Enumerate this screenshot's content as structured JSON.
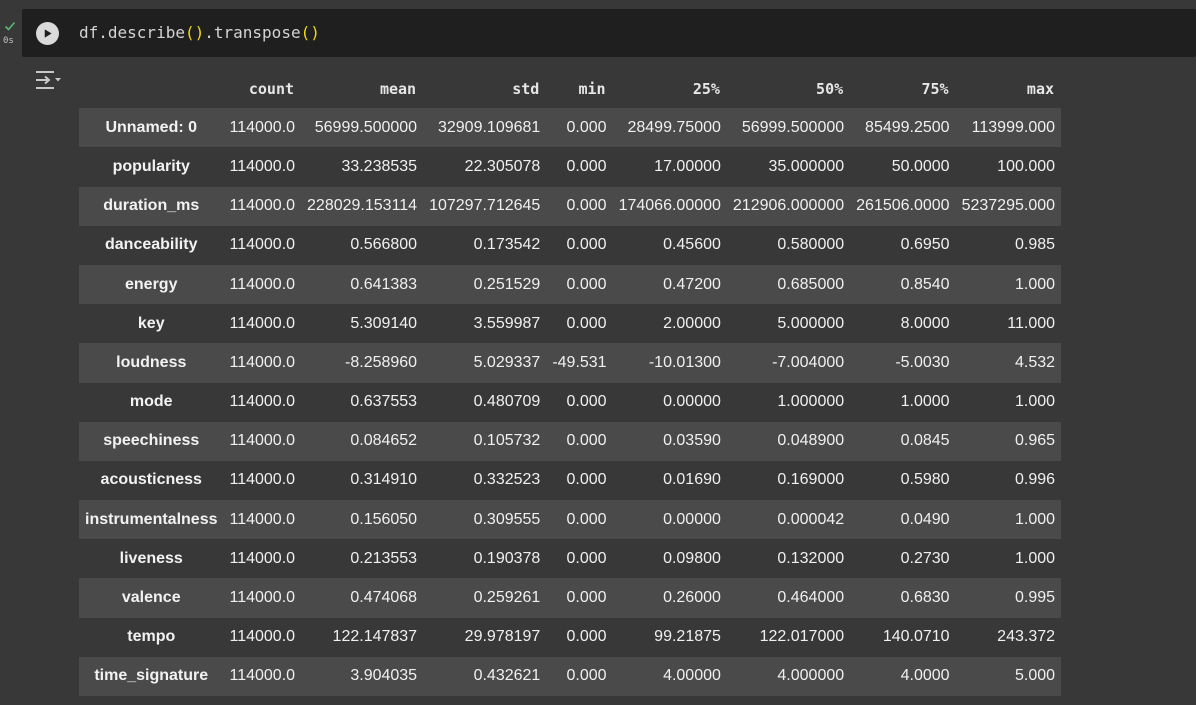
{
  "cell": {
    "exec_time": "0s",
    "code_parts": [
      "df.describe",
      "(",
      ")",
      ".transpose",
      "(",
      ")"
    ]
  },
  "table": {
    "columns": [
      "",
      "count",
      "mean",
      "std",
      "min",
      "25%",
      "50%",
      "75%",
      "max"
    ],
    "rows": [
      {
        "label": "Unnamed: 0",
        "values": [
          "114000.0",
          "56999.500000",
          "32909.109681",
          "0.000",
          "28499.75000",
          "56999.500000",
          "85499.2500",
          "113999.000"
        ]
      },
      {
        "label": "popularity",
        "values": [
          "114000.0",
          "33.238535",
          "22.305078",
          "0.000",
          "17.00000",
          "35.000000",
          "50.0000",
          "100.000"
        ]
      },
      {
        "label": "duration_ms",
        "values": [
          "114000.0",
          "228029.153114",
          "107297.712645",
          "0.000",
          "174066.00000",
          "212906.000000",
          "261506.0000",
          "5237295.000"
        ]
      },
      {
        "label": "danceability",
        "values": [
          "114000.0",
          "0.566800",
          "0.173542",
          "0.000",
          "0.45600",
          "0.580000",
          "0.6950",
          "0.985"
        ]
      },
      {
        "label": "energy",
        "values": [
          "114000.0",
          "0.641383",
          "0.251529",
          "0.000",
          "0.47200",
          "0.685000",
          "0.8540",
          "1.000"
        ]
      },
      {
        "label": "key",
        "values": [
          "114000.0",
          "5.309140",
          "3.559987",
          "0.000",
          "2.00000",
          "5.000000",
          "8.0000",
          "11.000"
        ]
      },
      {
        "label": "loudness",
        "values": [
          "114000.0",
          "-8.258960",
          "5.029337",
          "-49.531",
          "-10.01300",
          "-7.004000",
          "-5.0030",
          "4.532"
        ]
      },
      {
        "label": "mode",
        "values": [
          "114000.0",
          "0.637553",
          "0.480709",
          "0.000",
          "0.00000",
          "1.000000",
          "1.0000",
          "1.000"
        ]
      },
      {
        "label": "speechiness",
        "values": [
          "114000.0",
          "0.084652",
          "0.105732",
          "0.000",
          "0.03590",
          "0.048900",
          "0.0845",
          "0.965"
        ]
      },
      {
        "label": "acousticness",
        "values": [
          "114000.0",
          "0.314910",
          "0.332523",
          "0.000",
          "0.01690",
          "0.169000",
          "0.5980",
          "0.996"
        ]
      },
      {
        "label": "instrumentalness",
        "values": [
          "114000.0",
          "0.156050",
          "0.309555",
          "0.000",
          "0.00000",
          "0.000042",
          "0.0490",
          "1.000"
        ]
      },
      {
        "label": "liveness",
        "values": [
          "114000.0",
          "0.213553",
          "0.190378",
          "0.000",
          "0.09800",
          "0.132000",
          "0.2730",
          "1.000"
        ]
      },
      {
        "label": "valence",
        "values": [
          "114000.0",
          "0.474068",
          "0.259261",
          "0.000",
          "0.26000",
          "0.464000",
          "0.6830",
          "0.995"
        ]
      },
      {
        "label": "tempo",
        "values": [
          "114000.0",
          "122.147837",
          "29.978197",
          "0.000",
          "99.21875",
          "122.017000",
          "140.0710",
          "243.372"
        ]
      },
      {
        "label": "time_signature",
        "values": [
          "114000.0",
          "3.904035",
          "0.432621",
          "0.000",
          "4.00000",
          "4.000000",
          "4.0000",
          "5.000"
        ]
      }
    ]
  },
  "colors": {
    "background": "#383838",
    "code_background": "#1f1f1f",
    "striped_row": "#4a4a4a",
    "paren": "#f1d710",
    "check": "#5bb974"
  },
  "icons": {
    "status": "check-icon",
    "run": "play-icon",
    "output": "output-toggle-icon"
  }
}
